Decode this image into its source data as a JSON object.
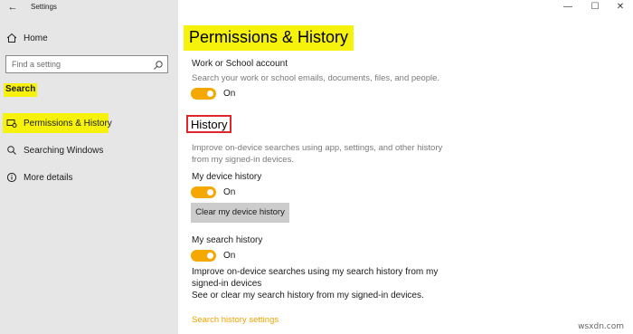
{
  "app": {
    "title": "Settings"
  },
  "window_controls": {
    "minimize": "—",
    "maximize": "☐",
    "close": "✕"
  },
  "sidebar": {
    "home_label": "Home",
    "search_placeholder": "Find a setting",
    "section_title": "Search",
    "items": [
      {
        "label": "Permissions & History",
        "icon": "permissions-icon",
        "active": true
      },
      {
        "label": "Searching Windows",
        "icon": "search-icon"
      },
      {
        "label": "More details",
        "icon": "info-icon"
      }
    ]
  },
  "main": {
    "title": "Permissions & History",
    "work_account": {
      "label": "Work or School account",
      "description": "Search your work or school emails, documents, files, and people.",
      "toggle_state": "On"
    },
    "history": {
      "heading": "History",
      "description_line1": "Improve on-device searches using app, settings, and other history",
      "description_line2": "from my signed-in devices.",
      "device_history_label": "My device history",
      "device_toggle_state": "On",
      "clear_button": "Clear my device history",
      "search_history_label": "My search history",
      "search_toggle_state": "On",
      "search_info_line1": "Improve on-device searches using my search history from my",
      "search_info_line2": "signed-in devices",
      "search_info_line3": "See or clear my search history from my signed-in devices.",
      "settings_link": "Search history settings"
    }
  },
  "watermark": "wsxdn.com",
  "colors": {
    "accent": "#f5a800",
    "highlight": "#f7f20b",
    "red_box": "#e0262b"
  }
}
